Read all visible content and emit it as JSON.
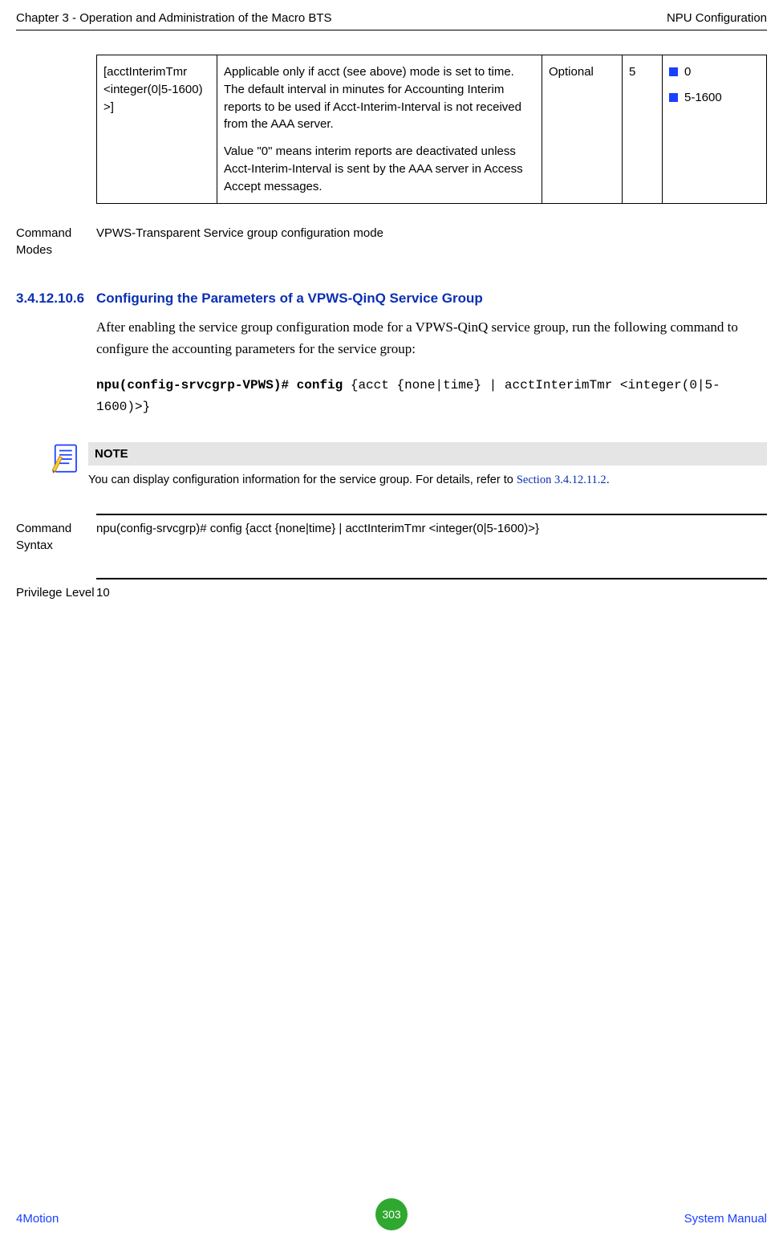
{
  "header": {
    "left": "Chapter 3 - Operation and Administration of the Macro BTS",
    "right": "NPU Configuration"
  },
  "param_row": {
    "syntax": "[acctInterimTmr <integer(0|5-1600) >]",
    "description1": "Applicable only if acct (see above) mode is set to time. The default interval in minutes for Accounting Interim reports to be used if Acct-Interim-Interval is not received from the AAA server.",
    "description2": "Value \"0\" means interim reports are deactivated unless Acct-Interim-Interval is sent by the AAA server in Access Accept messages.",
    "presence": "Optional",
    "default": "5",
    "possible": [
      "0",
      "5-1600"
    ]
  },
  "command_modes": {
    "label": "Command Modes",
    "value": "VPWS-Transparent Service group configuration mode"
  },
  "section": {
    "number": "3.4.12.10.6",
    "title": "Configuring the Parameters of a VPWS-QinQ Service Group",
    "body": "After enabling the service group configuration mode for a VPWS-QinQ service group, run the following command to configure the accounting parameters for the service group:"
  },
  "cmd": {
    "bold": "npu(config-srvcgrp-VPWS)# config",
    "rest": " {acct {none|time} | acctInterimTmr <integer(0|5-1600)>}"
  },
  "note": {
    "title": "NOTE",
    "body_pre": "You can display configuration information for the service group. For details, refer to ",
    "link": "Section 3.4.12.11.2",
    "body_post": "."
  },
  "command_syntax": {
    "label": "Command Syntax",
    "value": "npu(config-srvcgrp)# config {acct {none|time} | acctInterimTmr <integer(0|5-1600)>}"
  },
  "privilege": {
    "label": "Privilege Level",
    "value": "10"
  },
  "footer": {
    "left": "4Motion",
    "page": "303",
    "right": "System Manual"
  }
}
